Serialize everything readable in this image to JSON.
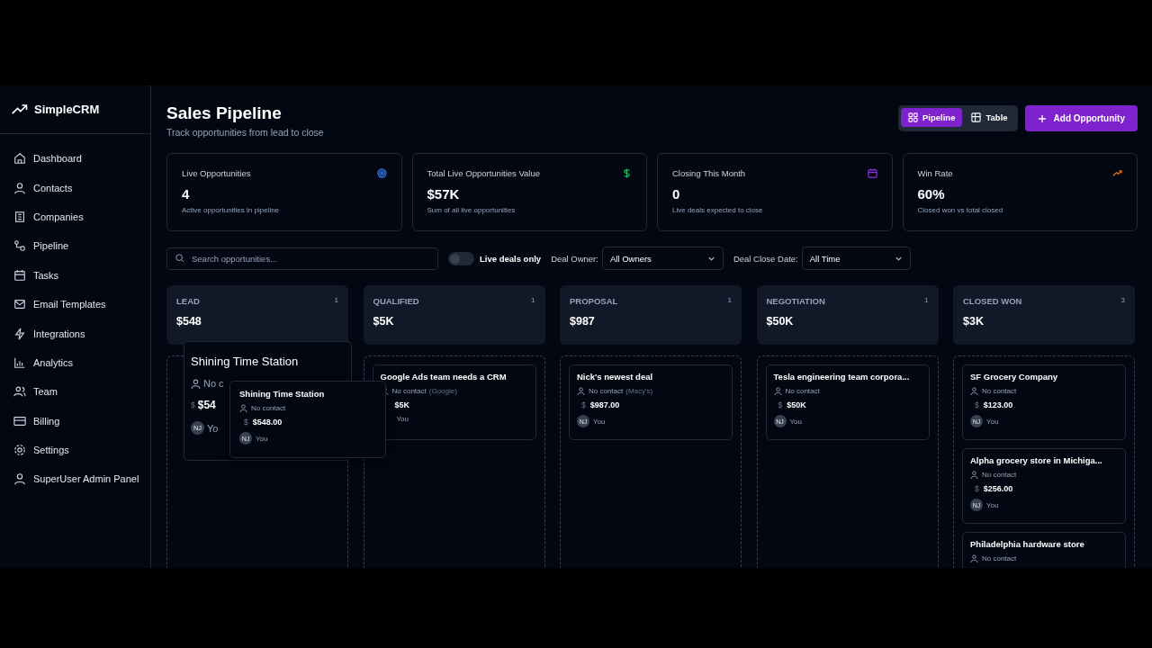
{
  "brand": "SimpleCRM",
  "nav": [
    {
      "label": "Dashboard",
      "selected": false
    },
    {
      "label": "Contacts",
      "selected": false
    },
    {
      "label": "Companies",
      "selected": false
    },
    {
      "label": "Pipeline",
      "selected": false
    },
    {
      "label": "Tasks",
      "selected": false
    },
    {
      "label": "Email Templates",
      "selected": false
    },
    {
      "label": "Integrations",
      "selected": false
    },
    {
      "label": "Analytics",
      "selected": false
    },
    {
      "label": "Team",
      "selected": false
    },
    {
      "label": "Billing",
      "selected": false
    },
    {
      "label": "Settings",
      "selected": false
    },
    {
      "label": "SuperUser Admin Panel",
      "selected": false
    }
  ],
  "header": {
    "title": "Sales Pipeline",
    "subtitle": "Track opportunities from lead to close"
  },
  "view_tabs": [
    {
      "label": "Pipeline",
      "selected": true
    },
    {
      "label": "Table",
      "selected": false
    }
  ],
  "add_button": "Add Opportunity",
  "stats": [
    {
      "label": "Live Opportunities",
      "value": "4",
      "note": "Active opportunities in pipeline"
    },
    {
      "label": "Total Live Opportunities Value",
      "value": "$57K",
      "note": "Sum of all live opportunities"
    },
    {
      "label": "Closing This Month",
      "value": "0",
      "note": "Live deals expected to close"
    },
    {
      "label": "Win Rate",
      "value": "60%",
      "note": "Closed won vs total closed"
    }
  ],
  "filters": {
    "search_placeholder": "Search opportunities...",
    "live_only": {
      "label": "Live deals only",
      "on": false
    },
    "owner_label": "Deal Owner:",
    "owner_value": "All Owners",
    "date_label": "Deal Close Date:",
    "date_value": "All Time"
  },
  "columns": [
    {
      "name": "LEAD",
      "count": "1",
      "total": "$548"
    },
    {
      "name": "QUALIFIED",
      "count": "1",
      "total": "$5K",
      "deals": [
        {
          "title": "Google Ads team needs a CRM",
          "contact": "No contact",
          "company": "(Google)",
          "amount": "$5K",
          "owner": "You"
        }
      ]
    },
    {
      "name": "PROPOSAL",
      "count": "1",
      "total": "$987",
      "deals": [
        {
          "title": "Nick's newest deal",
          "contact": "No contact",
          "company": "(Macy's)",
          "currency": "$",
          "amount": "$987.00",
          "initials": "NJ",
          "owner": "You"
        }
      ]
    },
    {
      "name": "NEGOTIATION",
      "count": "1",
      "total": "$50K",
      "deals": [
        {
          "title": "Tesla engineering team corpora...",
          "contact": "No contact",
          "currency": "$",
          "amount": "$50K",
          "initials": "NJ",
          "owner": "You"
        }
      ]
    },
    {
      "name": "CLOSED WON",
      "count": "3",
      "total": "$3K",
      "deals": [
        {
          "title": "SF Grocery Company",
          "contact": "No contact",
          "currency": "$",
          "amount": "$123.00",
          "initials": "NJ",
          "owner": "You"
        },
        {
          "title": "Alpha grocery store in Michiga...",
          "contact": "No contact",
          "currency": "$",
          "amount": "$256.00",
          "initials": "NJ",
          "owner": "You"
        },
        {
          "title": "Philadelphia hardware store",
          "contact": "No contact"
        }
      ]
    }
  ],
  "drag_ghost": {
    "title": "Shining Time Station",
    "contact": "No c",
    "currency": "$",
    "amount": "$54",
    "initials": "NJ",
    "owner": "Yo"
  },
  "drag_card": {
    "title": "Shining Time Station",
    "contact": "No contact",
    "currency": "$",
    "amount": "$548.00",
    "initials": "NJ",
    "owner": "You"
  }
}
